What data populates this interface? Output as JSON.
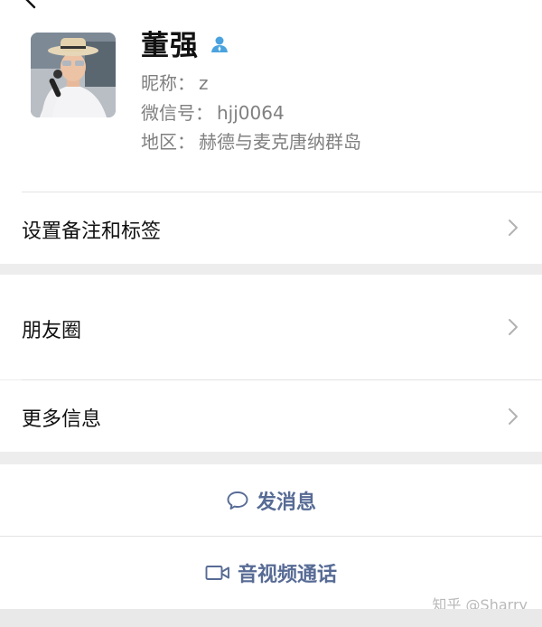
{
  "profile": {
    "name": "董强",
    "gender_icon": "male-user-icon",
    "nickname_label": "昵称：",
    "nickname": "z",
    "wechat_id_label": "微信号：",
    "wechat_id": "hjj0064",
    "region_label": "地区：",
    "region": "赫德与麦克唐纳群岛"
  },
  "menu": {
    "remark_tags": "设置备注和标签",
    "moments": "朋友圈",
    "more_info": "更多信息"
  },
  "actions": {
    "send_message": "发消息",
    "voice_video_call": "音视频通话"
  },
  "watermark": "知乎 @Sharry",
  "colors": {
    "accent_link": "#576b95",
    "gender_male": "#4aa3df",
    "background": "#ededed"
  }
}
